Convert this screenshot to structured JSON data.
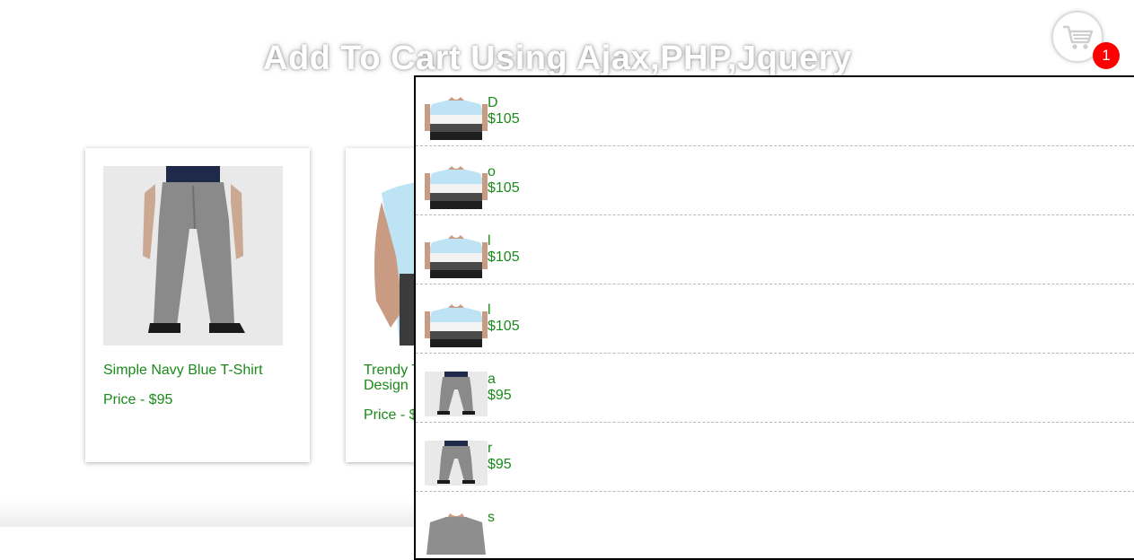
{
  "header": {
    "title": "Add To Cart Using Ajax,PHP,Jquery",
    "cart_icon": "shopping-cart-icon",
    "cart_count": "1",
    "badge_color": "#ff0000"
  },
  "products": [
    {
      "name": "Simple Navy Blue T-Shirt",
      "price": "Price - $95",
      "image": "grey-pants-photo"
    },
    {
      "name": "Trendy T\nDesign",
      "price": "Price - $",
      "image": "tshirt-model-photo"
    }
  ],
  "cart": {
    "items": [
      {
        "name": "D",
        "price": "$105",
        "thumb": "tshirt-thumb"
      },
      {
        "name": "o",
        "price": "$105",
        "thumb": "tshirt-thumb"
      },
      {
        "name": "l",
        "price": "$105",
        "thumb": "tshirt-thumb"
      },
      {
        "name": "l",
        "price": "$105",
        "thumb": "tshirt-thumb"
      },
      {
        "name": "a",
        "price": "$95",
        "thumb": "pants-thumb"
      },
      {
        "name": "r",
        "price": "$95",
        "thumb": "pants-thumb"
      },
      {
        "name": "s",
        "price": "",
        "thumb": "grey-shirt-thumb"
      }
    ]
  },
  "colors": {
    "accent_text": "#1a8a1a",
    "dropdown_border": "#000000"
  }
}
